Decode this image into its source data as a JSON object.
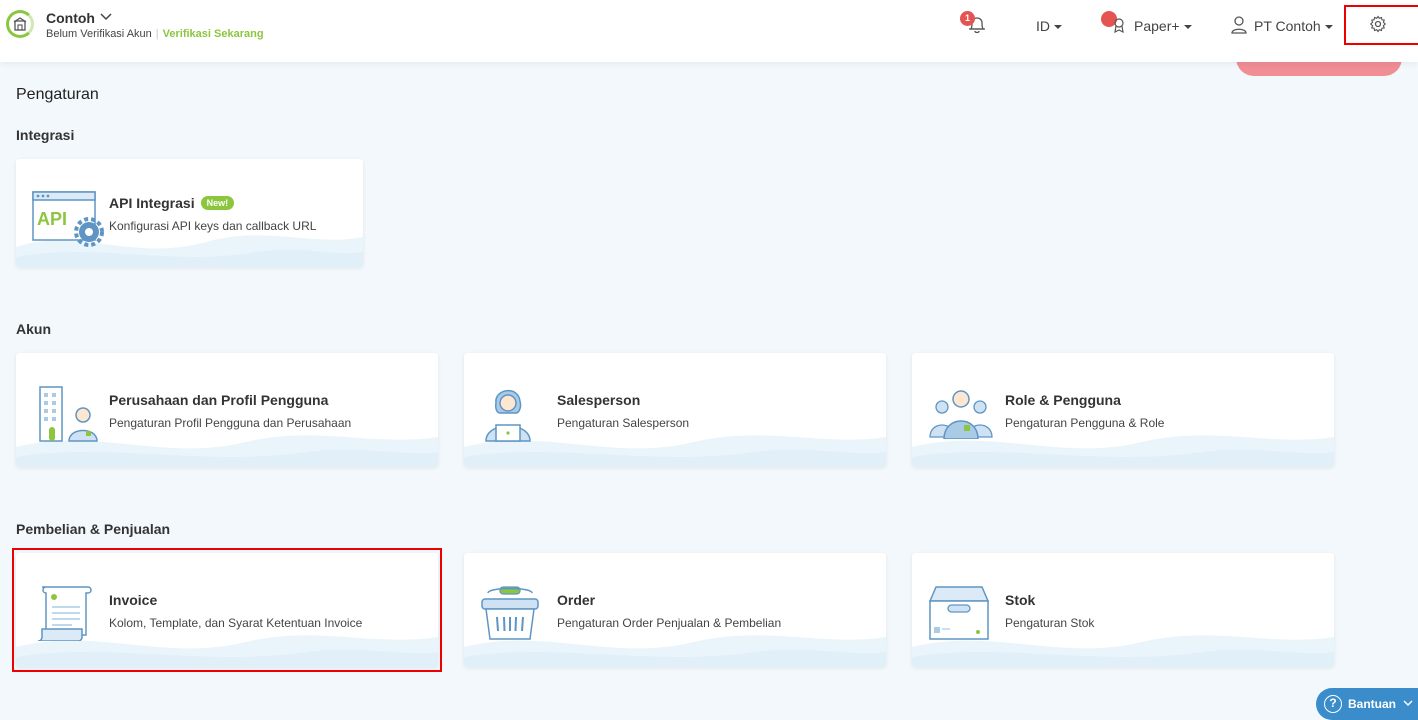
{
  "header": {
    "company_name": "Contoh",
    "verification_status": "Belum Verifikasi Akun",
    "verification_link": "Verifikasi Sekarang",
    "notification_count": "1",
    "language": "ID",
    "plan": "Paper+",
    "user": "PT Contoh"
  },
  "page": {
    "title": "Pengaturan"
  },
  "sections": {
    "integration": {
      "title": "Integrasi",
      "cards": [
        {
          "title": "API Integrasi",
          "badge": "New!",
          "desc": "Konfigurasi API keys dan callback URL",
          "icon": "api-icon"
        }
      ]
    },
    "account": {
      "title": "Akun",
      "cards": [
        {
          "title": "Perusahaan dan Profil Pengguna",
          "desc": "Pengaturan Profil Pengguna dan Perusahaan",
          "icon": "company-profile-icon"
        },
        {
          "title": "Salesperson",
          "desc": "Pengaturan Salesperson",
          "icon": "salesperson-icon"
        },
        {
          "title": "Role & Pengguna",
          "desc": "Pengaturan Pengguna & Role",
          "icon": "role-users-icon"
        }
      ]
    },
    "trade": {
      "title": "Pembelian & Penjualan",
      "cards": [
        {
          "title": "Invoice",
          "desc": "Kolom, Template, dan Syarat Ketentuan Invoice",
          "icon": "invoice-icon"
        },
        {
          "title": "Order",
          "desc": "Pengaturan Order Penjualan & Pembelian",
          "icon": "basket-icon"
        },
        {
          "title": "Stok",
          "desc": "Pengaturan Stok",
          "icon": "box-icon"
        }
      ]
    }
  },
  "help": {
    "label": "Bantuan"
  },
  "colors": {
    "accent_green": "#8cc63f",
    "alert_red": "#e55353",
    "help_blue": "#3b8ccb",
    "background": "#f2f8fc"
  }
}
